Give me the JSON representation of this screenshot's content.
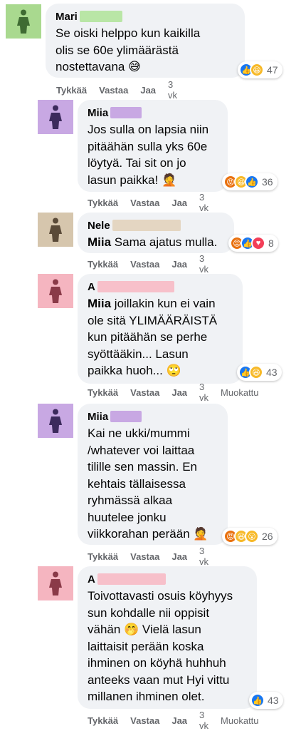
{
  "comments": [
    {
      "name": "Mari",
      "text": "Se oiski helppo kun kaikilla\nolis se 60e ylimäärästä\nnostettavana 😅",
      "reaction_count": "47",
      "actions": {
        "like": "Tykkää",
        "reply": "Vastaa",
        "share": "Jaa",
        "time": "3 vk",
        "edited": ""
      },
      "avatar_color": "#a9d98f",
      "redact_color": "#b9e6a6"
    },
    {
      "name": "Miia",
      "text": "Jos sulla on lapsia niin\npitäähän sulla yks 60e\nlöytyä. Tai sit on jo\nlasun paikka! 🤦",
      "reaction_count": "36",
      "actions": {
        "like": "Tykkää",
        "reply": "Vastaa",
        "share": "Jaa",
        "time": "3 vk",
        "edited": ""
      },
      "avatar_color": "#c8a8e3",
      "redact_color": "#c8a8e3"
    },
    {
      "name": "Nele",
      "mention": "Miia",
      "text": "Sama ajatus mulla.",
      "reaction_count": "8",
      "actions": {
        "like": "Tykkää",
        "reply": "Vastaa",
        "share": "Jaa",
        "time": "3 vk",
        "edited": ""
      },
      "avatar_color": "#d6c6ad",
      "redact_color": "#e4d6c2"
    },
    {
      "name": "A",
      "mention": "Miia",
      "text": "joillakin kun ei vain\nole sitä YLIMÄÄRÄISTÄ\nkun pitäähän se perhe\nsyöttääkin... Lasun\npaikka huoh... 🙄",
      "reaction_count": "43",
      "actions": {
        "like": "Tykkää",
        "reply": "Vastaa",
        "share": "Jaa",
        "time": "3 vk",
        "edited": "Muokattu"
      },
      "avatar_color": "#f5b5c0",
      "redact_color": "#f7c0ca"
    },
    {
      "name": "Miia",
      "text": "Kai ne ukki/mummi\n/whatever voi laittaa\ntilille sen massin. En\nkehtais tällaisessa\nryhmässä alkaa\nhuutelee jonku\nviikkorahan perään 🤦",
      "reaction_count": "26",
      "actions": {
        "like": "Tykkää",
        "reply": "Vastaa",
        "share": "Jaa",
        "time": "3 vk",
        "edited": ""
      },
      "avatar_color": "#c8a8e3",
      "redact_color": "#c8a8e3"
    },
    {
      "name": "A",
      "text": "Toivottavasti osuis köyhyys\nsun kohdalle nii oppisit\nvähän 🤭 Vielä lasun\nlaittaisit perään koska\nihminen on köyhä huhhuh\nanteeks vaan mut Hyi vittu\nmillanen ihminen olet.",
      "reaction_count": "43",
      "actions": {
        "like": "Tykkää",
        "reply": "Vastaa",
        "share": "Jaa",
        "time": "3 vk",
        "edited": "Muokattu"
      },
      "avatar_color": "#f5b5c0",
      "redact_color": "#f7c0ca"
    }
  ],
  "icons": {
    "avatar": "person-silhouette-icon",
    "like": "like-reaction-icon",
    "haha": "haha-reaction-icon",
    "angry": "angry-reaction-icon",
    "love": "love-reaction-icon",
    "wow": "wow-reaction-icon"
  },
  "colors": {
    "like": "#1877f2",
    "haha": "#f7b928",
    "angry": "#e9710f",
    "love": "#f33e58",
    "bubble": "#f0f2f5",
    "meta_text": "#65676b"
  }
}
